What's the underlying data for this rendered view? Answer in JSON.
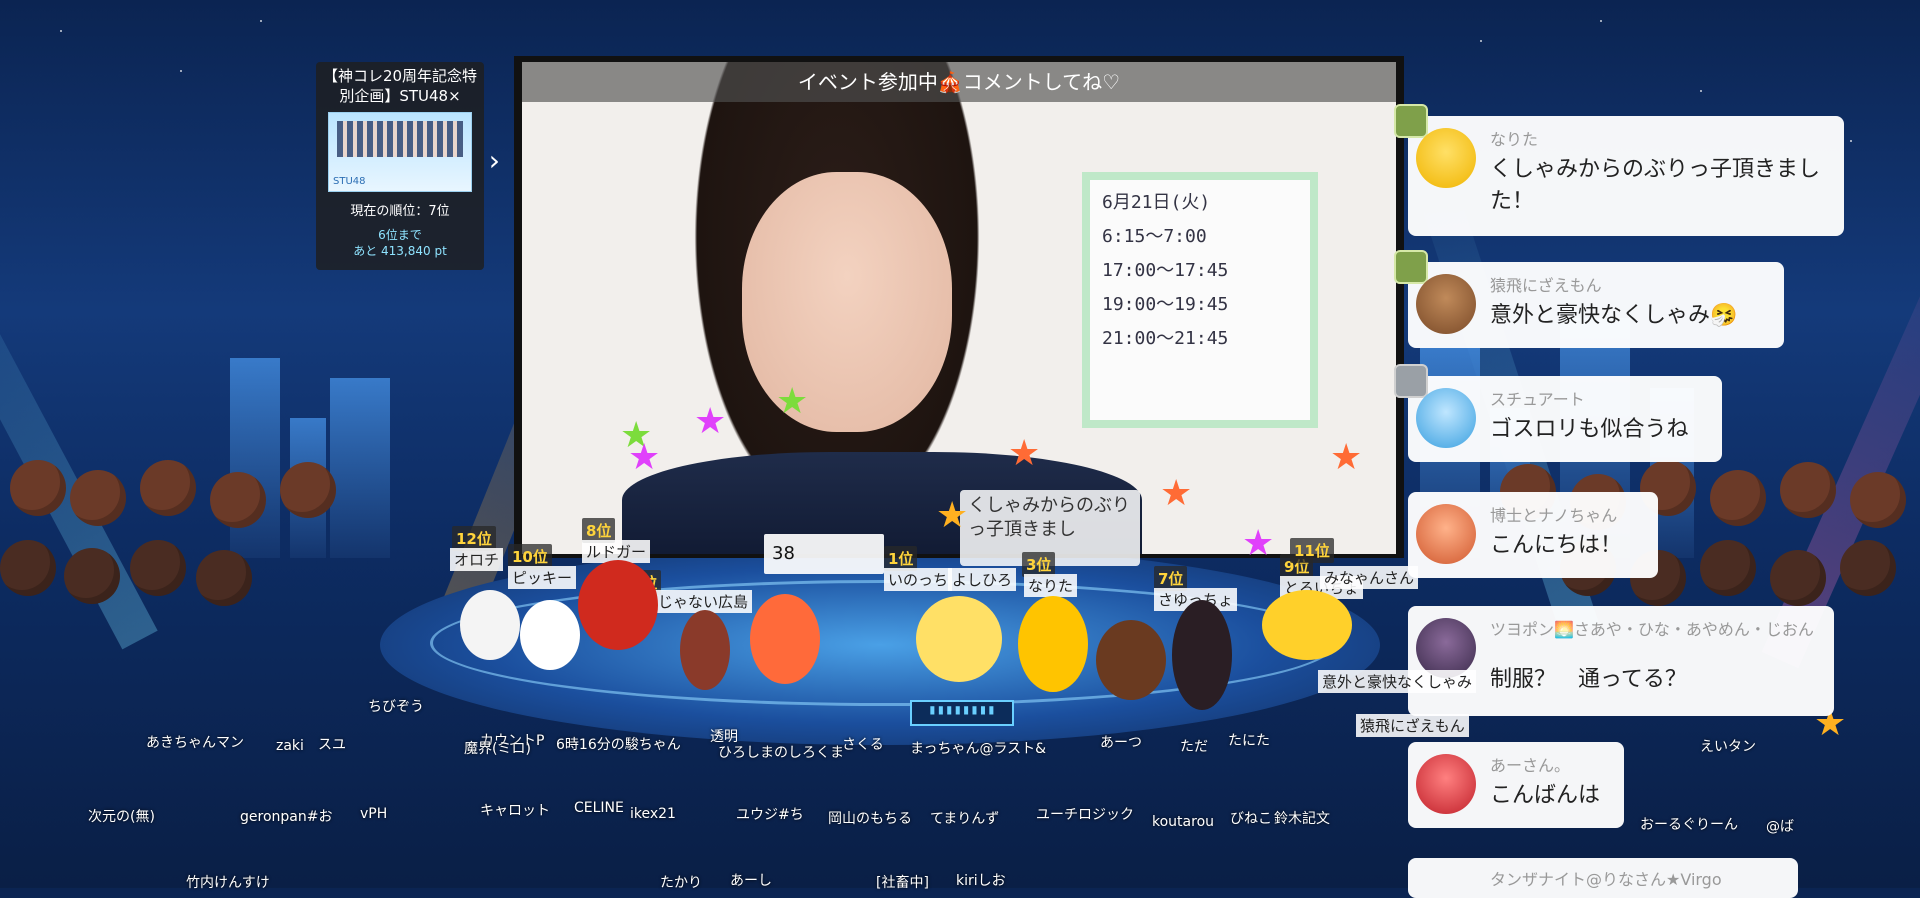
{
  "event": {
    "title": "【神コレ20周年記念特別企画】STU48×",
    "banner_logo": "STU48",
    "current_rank": "現在の順位：7位",
    "next_rank": "6位まで",
    "points_to_next": "あと 413,840 pt"
  },
  "video": {
    "top_banner": "イベント参加中🎪コメントしてね♡",
    "whiteboard_lines": [
      "6月21日(火)",
      "6:15〜7:00",
      "17:00〜17:45",
      "19:00〜19:45",
      "21:00〜21:45"
    ],
    "caption": "くしゃみからのぶりっ子頂きまし",
    "count_chip": "38"
  },
  "comments": [
    {
      "name": "なりた",
      "text": "くしゃみからのぶりっ子頂きました！",
      "badge": "green"
    },
    {
      "name": "猿飛にざえもん",
      "text": "意外と豪快なくしゃみ🤧",
      "badge": "green"
    },
    {
      "name": "スチュアート",
      "text": "ゴスロリも似合うね",
      "badge": "gray"
    },
    {
      "name": "博士とナノちゃん",
      "text": "こんにちは！",
      "badge": ""
    },
    {
      "name": "ツヨポン🌅さあや・ひな・あやめん・じおん",
      "text": "制服？　通ってる？",
      "badge": ""
    },
    {
      "name": "あーさん。",
      "text": "こんばんは",
      "badge": ""
    },
    {
      "name": "タンザナイト@りなさん★Virgo",
      "text": "",
      "badge": ""
    }
  ],
  "ranks": [
    {
      "rank": "12位",
      "name": "オロチ"
    },
    {
      "rank": "10位",
      "name": "ピッキー"
    },
    {
      "rank": "8位",
      "name": "ルドガー"
    },
    {
      "rank": "6位",
      "name": "いいじゃない広島"
    },
    {
      "rank": "1位",
      "name": "いのっち"
    },
    {
      "rank": "3位",
      "name": "なりた"
    },
    {
      "rank": "7位",
      "name": "さゆっちょ"
    },
    {
      "rank": "9位",
      "name": "とろいちょ"
    },
    {
      "rank": "11位",
      "name": "みなゃんさん"
    }
  ],
  "stage_names": [
    "よしひろ",
    "なりた",
    "意外と豪快なくしゃみ",
    "猿飛にざえもん"
  ],
  "audience_names": [
    "ちびぞう",
    "あきちゃんマン",
    "zaki",
    "スユ",
    "カウントP",
    "魔界(ミロ)",
    "6時16分の駿ちゃん",
    "透明",
    "ひろしまのしろくま",
    "さくる",
    "まっちゃん@ラスト&",
    "あーつ",
    "ただ",
    "たにた",
    "えいタン",
    "次元の(無)",
    "geronpan#お",
    "vPH",
    "キャロット",
    "CELINE",
    "ikex21",
    "ユウジ#ち",
    "岡山のもちる",
    "てまりんず",
    "ユーチロジック",
    "koutarou",
    "びねこ",
    "鈴木記文",
    "竹内けんすけ",
    "たかり",
    "あーし",
    "[社畜中]",
    "kiriしお",
    "おーるぐりーん",
    "@ば"
  ],
  "stage_led": "▮▮▮▮▮▮▮▮",
  "colors": {
    "accent_gold": "#ffd43b",
    "rank_bg": "#282828",
    "sky": "#0b2452"
  }
}
